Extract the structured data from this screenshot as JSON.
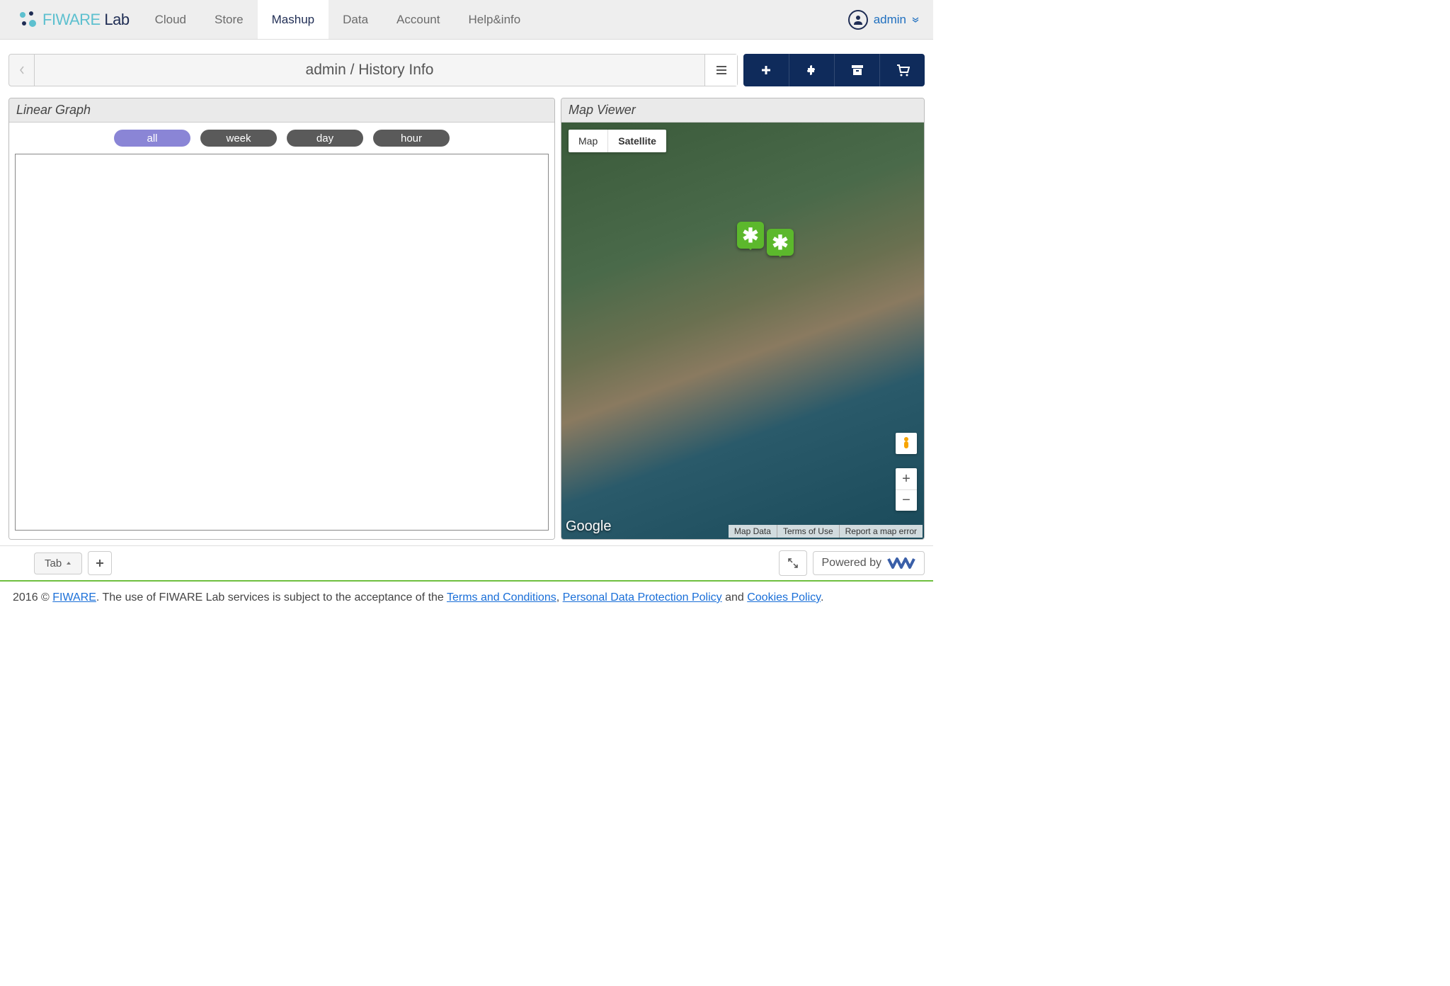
{
  "brand": {
    "name": "FIWARE",
    "suffix": "Lab"
  },
  "nav": {
    "items": [
      {
        "label": "Cloud"
      },
      {
        "label": "Store"
      },
      {
        "label": "Mashup",
        "active": true
      },
      {
        "label": "Data"
      },
      {
        "label": "Account"
      },
      {
        "label": "Help&info"
      }
    ]
  },
  "user": {
    "name": "admin"
  },
  "breadcrumb": {
    "title": "admin / History Info"
  },
  "actions": {
    "add_icon": "plus",
    "puzzle_icon": "puzzle",
    "archive_icon": "archive",
    "cart_icon": "cart"
  },
  "panels": {
    "graph": {
      "title": "Linear Graph",
      "filters": [
        {
          "label": "all",
          "active": true
        },
        {
          "label": "week"
        },
        {
          "label": "day"
        },
        {
          "label": "hour"
        }
      ]
    },
    "map": {
      "title": "Map Viewer",
      "type_controls": [
        {
          "label": "Map"
        },
        {
          "label": "Satellite",
          "active": true
        }
      ],
      "provider": "Google",
      "footer_links": [
        "Map Data",
        "Terms of Use",
        "Report a map error"
      ]
    }
  },
  "bottombar": {
    "tab_label": "Tab",
    "powered_by": "Powered by"
  },
  "footer": {
    "copyright": "2016 © ",
    "brand_link": "FIWARE",
    "text1": ". The use of FIWARE Lab services is subject to the acceptance of the ",
    "link_terms": "Terms and Conditions",
    "sep1": ", ",
    "link_privacy": "Personal Data Protection Policy",
    "sep2": " and ",
    "link_cookies": "Cookies Policy",
    "end": "."
  }
}
